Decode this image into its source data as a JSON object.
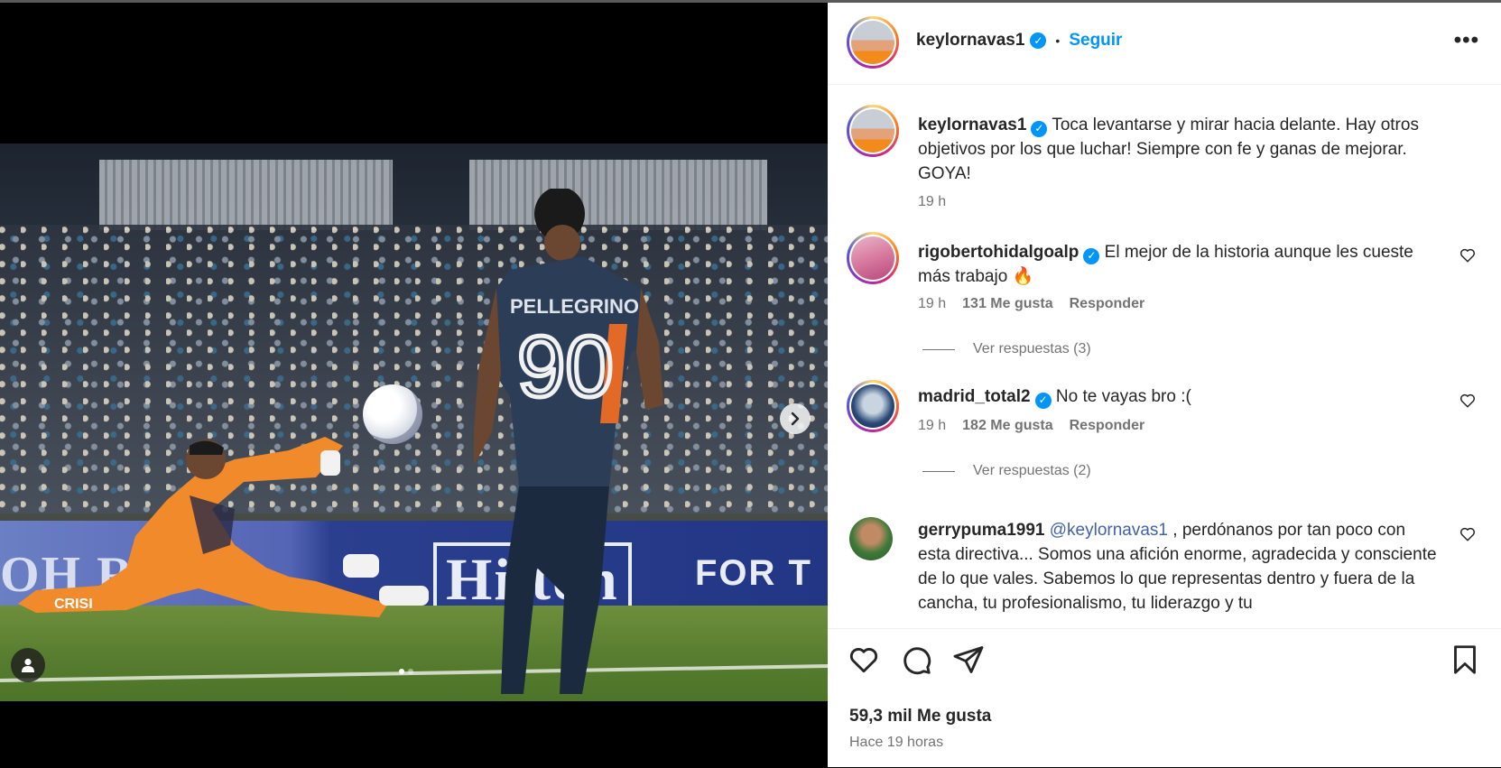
{
  "post": {
    "media": {
      "jersey_name": "PELLEGRINO",
      "jersey_number": "90",
      "ad_left": "OH  R",
      "ad_center": "Hilton",
      "ad_right": "FOR T",
      "keeper_jersey": "CRISI",
      "carousel_count": 2,
      "carousel_active": 0
    },
    "header": {
      "username": "keylornavas1",
      "separator": "•",
      "follow_label": "Seguir",
      "more_label": "•••"
    },
    "caption": {
      "username": "keylornavas1",
      "text": "Toca levantarse y mirar hacia delante. Hay otros objetivos por los que luchar! Siempre con fe y ganas de mejorar. GOYA!",
      "time": "19 h"
    },
    "comments": [
      {
        "username": "rigobertohidalgoalp",
        "verified": true,
        "text": "El mejor de la historia aunque les cueste más trabajo 🔥",
        "time": "19 h",
        "likes": "131 Me gusta",
        "reply_label": "Responder",
        "view_replies": "Ver respuestas (3)"
      },
      {
        "username": "madrid_total2",
        "verified": true,
        "text": "No te vayas bro :(",
        "time": "19 h",
        "likes": "182 Me gusta",
        "reply_label": "Responder",
        "view_replies": "Ver respuestas (2)"
      },
      {
        "username": "gerrypuma1991",
        "verified": false,
        "mention": "@keylornavas1",
        "text": ", perdónanos por tan poco con esta directiva... Somos una afición enorme, agradecida y consciente de lo que vales. Sabemos lo que representas dentro y fuera de la cancha, tu profesionalismo, tu liderazgo y tu"
      }
    ],
    "footer": {
      "likes": "59,3 mil Me gusta",
      "time_ago": "Hace 19 horas"
    },
    "colors": {
      "accent": "#0095f6",
      "mention": "#4262a8",
      "secondary_text": "#737373"
    }
  }
}
